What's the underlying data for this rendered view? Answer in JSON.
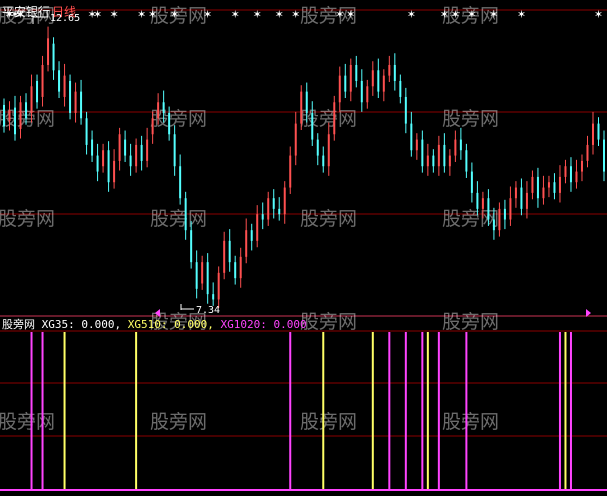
{
  "header": {
    "stock_name": "平安银行",
    "period": "日线",
    "high_label": "12.65",
    "low_label": "7.34"
  },
  "indicator": {
    "name": "股旁网",
    "items": [
      {
        "key": "XG35",
        "value": "0.000",
        "color": "#ffffff"
      },
      {
        "key": "XG510",
        "value": "0.000",
        "color": "#ffff66"
      },
      {
        "key": "XG1020",
        "value": "0.000",
        "color": "#ff44ff"
      }
    ]
  },
  "watermark": "股旁网",
  "colors": {
    "up": "#ff5050",
    "down": "#54ffff",
    "grid": "#8b0000",
    "signal_a": "#ff44ff",
    "signal_b": "#ffff66"
  },
  "chart_data": {
    "type": "candlestick",
    "price_high": 12.65,
    "price_low": 7.34,
    "candles": [
      {
        "o": 11.15,
        "c": 10.75
      },
      {
        "o": 10.85,
        "c": 11.05
      },
      {
        "o": 11.1,
        "c": 10.6
      },
      {
        "o": 10.7,
        "c": 11.2
      },
      {
        "o": 11.2,
        "c": 10.9
      },
      {
        "o": 11.0,
        "c": 11.5
      },
      {
        "o": 11.6,
        "c": 11.2
      },
      {
        "o": 11.3,
        "c": 11.9
      },
      {
        "o": 11.9,
        "c": 12.4
      },
      {
        "o": 12.3,
        "c": 11.8
      },
      {
        "o": 11.8,
        "c": 11.4
      },
      {
        "o": 11.3,
        "c": 11.7
      },
      {
        "o": 11.6,
        "c": 11.0
      },
      {
        "o": 11.0,
        "c": 11.4
      },
      {
        "o": 11.4,
        "c": 10.9
      },
      {
        "o": 10.9,
        "c": 10.4
      },
      {
        "o": 10.5,
        "c": 10.2
      },
      {
        "o": 10.2,
        "c": 9.9
      },
      {
        "o": 10.0,
        "c": 10.3
      },
      {
        "o": 10.3,
        "c": 9.7
      },
      {
        "o": 9.7,
        "c": 10.1
      },
      {
        "o": 10.1,
        "c": 10.6
      },
      {
        "o": 10.5,
        "c": 10.2
      },
      {
        "o": 10.2,
        "c": 10.0
      },
      {
        "o": 10.0,
        "c": 10.4
      },
      {
        "o": 10.4,
        "c": 10.1
      },
      {
        "o": 10.1,
        "c": 10.5
      },
      {
        "o": 10.6,
        "c": 10.9
      },
      {
        "o": 10.9,
        "c": 11.2
      },
      {
        "o": 11.2,
        "c": 11.0
      },
      {
        "o": 11.0,
        "c": 10.6
      },
      {
        "o": 10.6,
        "c": 10.0
      },
      {
        "o": 10.0,
        "c": 9.4
      },
      {
        "o": 9.4,
        "c": 8.8
      },
      {
        "o": 8.8,
        "c": 8.2
      },
      {
        "o": 8.2,
        "c": 7.7
      },
      {
        "o": 7.8,
        "c": 8.2
      },
      {
        "o": 8.2,
        "c": 7.6
      },
      {
        "o": 7.6,
        "c": 7.5
      },
      {
        "o": 7.5,
        "c": 8.0
      },
      {
        "o": 8.0,
        "c": 8.6
      },
      {
        "o": 8.6,
        "c": 8.2
      },
      {
        "o": 8.2,
        "c": 7.9
      },
      {
        "o": 7.9,
        "c": 8.3
      },
      {
        "o": 8.3,
        "c": 8.8
      },
      {
        "o": 8.8,
        "c": 8.6
      },
      {
        "o": 8.6,
        "c": 9.1
      },
      {
        "o": 9.1,
        "c": 9.0
      },
      {
        "o": 9.0,
        "c": 9.4
      },
      {
        "o": 9.4,
        "c": 9.2
      },
      {
        "o": 9.2,
        "c": 9.1
      },
      {
        "o": 9.1,
        "c": 9.6
      },
      {
        "o": 9.6,
        "c": 10.2
      },
      {
        "o": 10.2,
        "c": 10.8
      },
      {
        "o": 10.8,
        "c": 11.4
      },
      {
        "o": 11.4,
        "c": 11.0
      },
      {
        "o": 11.0,
        "c": 10.5
      },
      {
        "o": 10.5,
        "c": 10.2
      },
      {
        "o": 10.2,
        "c": 10.0
      },
      {
        "o": 10.0,
        "c": 10.6
      },
      {
        "o": 10.6,
        "c": 11.2
      },
      {
        "o": 11.2,
        "c": 11.7
      },
      {
        "o": 11.7,
        "c": 11.4
      },
      {
        "o": 11.4,
        "c": 11.9
      },
      {
        "o": 11.9,
        "c": 11.6
      },
      {
        "o": 11.6,
        "c": 11.2
      },
      {
        "o": 11.2,
        "c": 11.5
      },
      {
        "o": 11.5,
        "c": 11.8
      },
      {
        "o": 11.8,
        "c": 11.4
      },
      {
        "o": 11.4,
        "c": 11.7
      },
      {
        "o": 11.7,
        "c": 11.9
      },
      {
        "o": 11.9,
        "c": 11.6
      },
      {
        "o": 11.6,
        "c": 11.3
      },
      {
        "o": 11.3,
        "c": 10.8
      },
      {
        "o": 10.8,
        "c": 10.3
      },
      {
        "o": 10.3,
        "c": 10.5
      },
      {
        "o": 10.5,
        "c": 10.0
      },
      {
        "o": 10.0,
        "c": 10.2
      },
      {
        "o": 10.2,
        "c": 10.0
      },
      {
        "o": 10.0,
        "c": 10.4
      },
      {
        "o": 10.4,
        "c": 10.0
      },
      {
        "o": 10.0,
        "c": 10.2
      },
      {
        "o": 10.2,
        "c": 10.5
      },
      {
        "o": 10.5,
        "c": 10.3
      },
      {
        "o": 10.3,
        "c": 9.9
      },
      {
        "o": 9.9,
        "c": 9.5
      },
      {
        "o": 9.5,
        "c": 9.2
      },
      {
        "o": 9.2,
        "c": 9.4
      },
      {
        "o": 9.4,
        "c": 9.0
      },
      {
        "o": 9.0,
        "c": 8.8
      },
      {
        "o": 8.8,
        "c": 9.2
      },
      {
        "o": 9.2,
        "c": 9.0
      },
      {
        "o": 9.0,
        "c": 9.4
      },
      {
        "o": 9.4,
        "c": 9.6
      },
      {
        "o": 9.6,
        "c": 9.2
      },
      {
        "o": 9.2,
        "c": 9.5
      },
      {
        "o": 9.5,
        "c": 9.8
      },
      {
        "o": 9.8,
        "c": 9.4
      },
      {
        "o": 9.4,
        "c": 9.6
      },
      {
        "o": 9.6,
        "c": 9.7
      },
      {
        "o": 9.7,
        "c": 9.5
      },
      {
        "o": 9.5,
        "c": 9.8
      },
      {
        "o": 9.8,
        "c": 10.0
      },
      {
        "o": 10.0,
        "c": 9.7
      },
      {
        "o": 9.7,
        "c": 9.9
      },
      {
        "o": 9.9,
        "c": 10.1
      },
      {
        "o": 10.1,
        "c": 10.4
      },
      {
        "o": 10.4,
        "c": 10.8
      },
      {
        "o": 10.8,
        "c": 10.5
      },
      {
        "o": 10.5,
        "c": 9.9
      }
    ],
    "signals": [
      {
        "i": 5,
        "color": "#ff44ff"
      },
      {
        "i": 7,
        "color": "#ff44ff"
      },
      {
        "i": 11,
        "color": "#ffff66"
      },
      {
        "i": 24,
        "color": "#ffff66"
      },
      {
        "i": 52,
        "color": "#ff44ff"
      },
      {
        "i": 58,
        "color": "#ffff66"
      },
      {
        "i": 67,
        "color": "#ffff66"
      },
      {
        "i": 70,
        "color": "#ff44ff"
      },
      {
        "i": 73,
        "color": "#ff44ff"
      },
      {
        "i": 76,
        "color": "#ff44ff"
      },
      {
        "i": 77,
        "color": "#ffff66"
      },
      {
        "i": 79,
        "color": "#ff44ff"
      },
      {
        "i": 84,
        "color": "#ff44ff"
      },
      {
        "i": 101,
        "color": "#ff44ff"
      },
      {
        "i": 102,
        "color": "#ffff66"
      },
      {
        "i": 103,
        "color": "#ff44ff"
      },
      {
        "i": 122,
        "color": "#ff44ff"
      },
      {
        "i": 124,
        "color": "#ff44ff"
      },
      {
        "i": 126,
        "color": "#ff44ff"
      },
      {
        "i": 127,
        "color": "#ffff66"
      },
      {
        "i": 137,
        "color": "#ffff66"
      }
    ],
    "top_markers": [
      1,
      2,
      3,
      16,
      17,
      20,
      25,
      27,
      31,
      37,
      42,
      46,
      50,
      53,
      61,
      63,
      74,
      80,
      82,
      85,
      89,
      94,
      108,
      113
    ]
  }
}
